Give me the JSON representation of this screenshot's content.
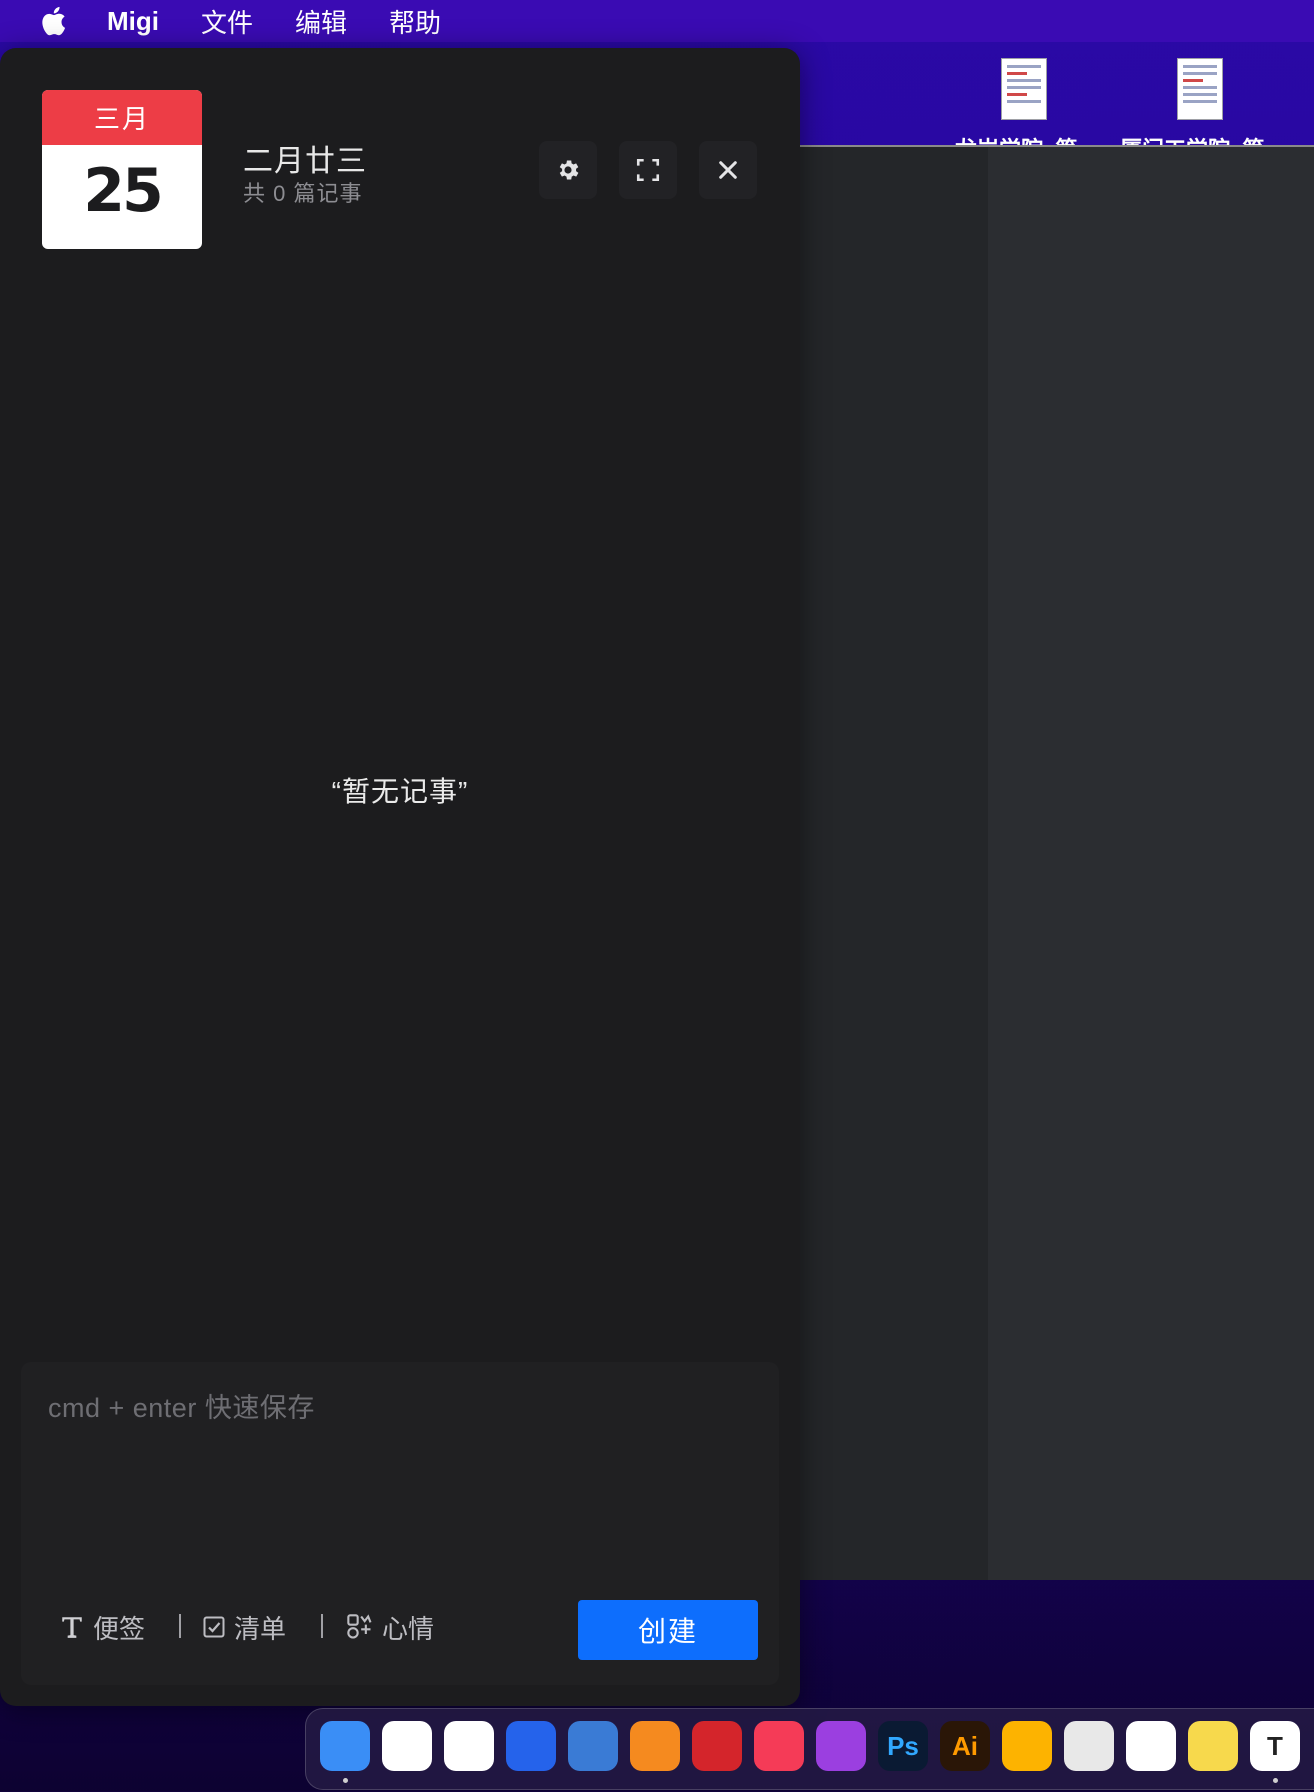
{
  "menubar": {
    "app_name": "Migi",
    "items": [
      "文件",
      "编辑",
      "帮助"
    ]
  },
  "desktop": {
    "files": [
      {
        "label": "龙岩学院_第..."
      },
      {
        "label": "厦门工学院_第..."
      }
    ]
  },
  "window": {
    "calendar": {
      "month": "三月",
      "day": "25"
    },
    "lunar_date": "二月廿三",
    "note_count": "共 0 篇记事",
    "controls": {
      "settings_icon": "gear-icon",
      "fullscreen_icon": "fullscreen-icon",
      "close_icon": "close-icon"
    },
    "empty_message": "“暂无记事”",
    "composer": {
      "placeholder": "cmd + enter 快速保存",
      "value": "",
      "types": [
        {
          "label": "便签",
          "icon": "text-icon"
        },
        {
          "label": "清单",
          "icon": "checkbox-icon"
        },
        {
          "label": "心情",
          "icon": "mood-icon"
        }
      ],
      "separator": "|",
      "create_label": "创建"
    }
  },
  "dock": {
    "apps": [
      {
        "name": "finder",
        "label": "",
        "color": "#3a8ef6",
        "running": true
      },
      {
        "name": "baidu-netdisk",
        "label": "",
        "color": "#ffffff",
        "running": false
      },
      {
        "name": "browser",
        "label": "",
        "color": "#ffffff",
        "running": false
      },
      {
        "name": "app-blue",
        "label": "",
        "color": "#2563eb",
        "running": false
      },
      {
        "name": "infuse",
        "label": "",
        "color": "#3a7bd5",
        "running": false
      },
      {
        "name": "books",
        "label": "",
        "color": "#f58a1f",
        "running": false
      },
      {
        "name": "netease-music",
        "label": "",
        "color": "#d4252b",
        "running": false
      },
      {
        "name": "music",
        "label": "",
        "color": "#f53b57",
        "running": false
      },
      {
        "name": "podcasts",
        "label": "",
        "color": "#9b3fe0",
        "running": false
      },
      {
        "name": "photoshop",
        "label": "Ps",
        "color": "#0a1a33",
        "text_color": "#31a8ff",
        "running": false
      },
      {
        "name": "illustrator",
        "label": "Ai",
        "color": "#2a1607",
        "text_color": "#ff9a00",
        "running": false
      },
      {
        "name": "sketch",
        "label": "",
        "color": "#fdb300",
        "running": false
      },
      {
        "name": "pixelmator",
        "label": "",
        "color": "#e8e8e8",
        "running": false
      },
      {
        "name": "photos",
        "label": "",
        "color": "#ffffff",
        "running": false
      },
      {
        "name": "notes",
        "label": "",
        "color": "#f7d94c",
        "running": false
      },
      {
        "name": "typora",
        "label": "T",
        "color": "#ffffff",
        "text_color": "#222222",
        "running": true
      }
    ]
  },
  "colors": {
    "accent": "#0d6efd",
    "calendar_red": "#ed3d46",
    "window_bg": "#1c1c1e"
  }
}
